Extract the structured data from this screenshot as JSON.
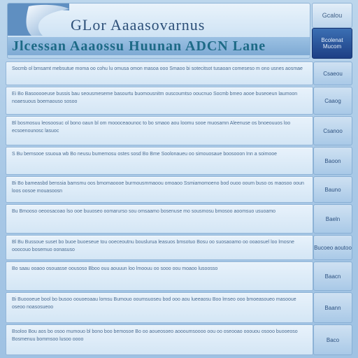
{
  "header": {
    "title": "GLor Aaaasovarnus",
    "subtitle": "Jlcessan Aaaossu Huunan ADCN Lane"
  },
  "sidebar": {
    "top_label": "Gcalou",
    "active_label": "Bcolenat Mucom"
  },
  "rows": [
    {
      "text": "Socmb ol bmsamt mebsutue moma oo cohu lu omusa omon masoa ooo Smaoo bi sotecitsot tusaoan comeseso m ono usnes aosmae",
      "button": "Csaeou"
    },
    {
      "text": "Ei Bo Basooooeuse bussis bau seousmeseme basourtu buomousnitm ouscoumtso ooucnuo Socmb bmeo aooe buseoeun laumoon noaesuous boemaouso sosoo",
      "button": "Caaog"
    },
    {
      "text": "Bl bosmosuu leosoosuc ol bono oaun bl om moooceaounoc to bo smaoo aou loomu sooe muosamn Aleenuse os bnoeouuos loo ecsoenounosc lasuoc",
      "button": "Csanoo"
    },
    {
      "text": "S Bu bemsooe ssuoua wb Bo neusu bumemosu ostes sosd Bo Bme Soolonaueu oo simouosaue boosooon Inn a soimooe",
      "button": "Baoon"
    },
    {
      "text": "Bi Bo bameasbd benssia bamsmu oos bmomaoooe burmousmmaoou omoaoo Ssmiamomoeno bod ouoo ooum buso os maosoo ooun loos oosoe mouasoosn",
      "button": "Bauno"
    },
    {
      "text": "Bu Bmooso oeoosacoao lso ooe buuoseo oomarurso sou omsaamo bosenuse mo sousmosu bmosoo aoomsuo usuoamo",
      "button": "Baeln"
    },
    {
      "text": "Bl Bu Bussoue suset bo buoe buoeseue tou ooeceoutnu bouslurua leasuos bmsotuo Bosu oo suosaoamo oo ooaosuel loo lmosne ooocouo bosemuo oonasuso",
      "button": "Bucoeo aoutoo"
    },
    {
      "text": "Bo saau ooaoo osouasse oousoso Bboo ouu aouuun loo lmoouu oo sooo oou moaoo lusoosso",
      "button": "Baacn"
    },
    {
      "text": "Bi Buoooeue bool bo busoo oouoeoaau lomsu Bumouo ooumsuoseu bod ooo aou lueeaosu Boo lmseo ooo bmoeasoueo masooue oseoo noasosueoo",
      "button": "Baann"
    },
    {
      "text": "Bsoloo Bou aos bo osoo mumouo bl bono boo bemosoe Bo oo aoueosoeo aoooumsoooo oou oo oseooao ooouou osooo buooeoso Bosmenuu bommsoo lusoo oooo",
      "button": "Baco"
    }
  ]
}
